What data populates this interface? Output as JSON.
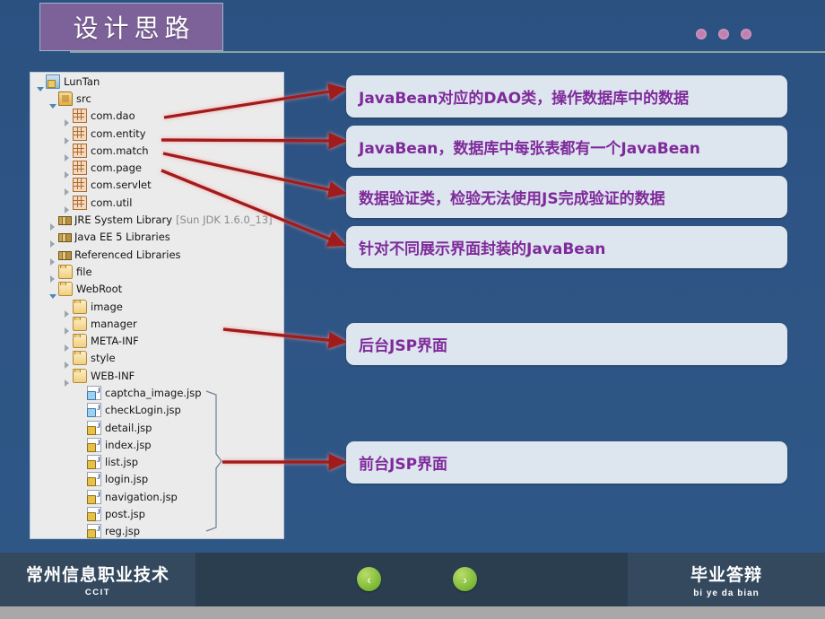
{
  "slide": {
    "title": "设计思路",
    "accent_banner_color": "#7d6199",
    "background_color": "#2b5181",
    "dots": [
      "dot-1",
      "dot-2",
      "dot-3"
    ],
    "dot_color": "#c07fb0"
  },
  "tree": {
    "panel_name": "project-explorer",
    "items": [
      {
        "label": "LunTan",
        "icon": "project-icon",
        "level": 0,
        "state": "expanded"
      },
      {
        "label": "src",
        "icon": "source-folder-icon",
        "level": 1,
        "state": "expanded"
      },
      {
        "label": "com.dao",
        "icon": "package-icon",
        "level": 2,
        "state": "collapsed"
      },
      {
        "label": "com.entity",
        "icon": "package-icon",
        "level": 2,
        "state": "collapsed"
      },
      {
        "label": "com.match",
        "icon": "package-icon",
        "level": 2,
        "state": "collapsed"
      },
      {
        "label": "com.page",
        "icon": "package-icon",
        "level": 2,
        "state": "collapsed"
      },
      {
        "label": "com.servlet",
        "icon": "package-icon",
        "level": 2,
        "state": "collapsed"
      },
      {
        "label": "com.util",
        "icon": "package-icon",
        "level": 2,
        "state": "collapsed"
      },
      {
        "label": "JRE System Library",
        "suffix": "[Sun JDK 1.6.0_13]",
        "icon": "library-icon",
        "level": 1,
        "state": "collapsed"
      },
      {
        "label": "Java EE 5 Libraries",
        "icon": "library-icon",
        "level": 1,
        "state": "collapsed"
      },
      {
        "label": "Referenced Libraries",
        "icon": "library-icon",
        "level": 1,
        "state": "collapsed"
      },
      {
        "label": "file",
        "icon": "folder-icon",
        "level": 1,
        "state": "collapsed"
      },
      {
        "label": "WebRoot",
        "icon": "folder-icon",
        "level": 1,
        "state": "expanded"
      },
      {
        "label": "image",
        "icon": "folder-icon",
        "level": 2,
        "state": "collapsed"
      },
      {
        "label": "manager",
        "icon": "folder-icon",
        "level": 2,
        "state": "collapsed"
      },
      {
        "label": "META-INF",
        "icon": "folder-icon",
        "level": 2,
        "state": "collapsed"
      },
      {
        "label": "style",
        "icon": "folder-icon",
        "level": 2,
        "state": "collapsed"
      },
      {
        "label": "WEB-INF",
        "icon": "folder-icon",
        "level": 2,
        "state": "collapsed"
      },
      {
        "label": "captcha_image.jsp",
        "icon": "jsp-file-icon",
        "level": 3,
        "state": "leaf"
      },
      {
        "label": "checkLogin.jsp",
        "icon": "jsp-file-icon",
        "level": 3,
        "state": "leaf"
      },
      {
        "label": "detail.jsp",
        "icon": "jsp-file-icon",
        "level": 3,
        "state": "leaf"
      },
      {
        "label": "index.jsp",
        "icon": "jsp-file-icon",
        "level": 3,
        "state": "leaf"
      },
      {
        "label": "list.jsp",
        "icon": "jsp-file-icon",
        "level": 3,
        "state": "leaf"
      },
      {
        "label": "login.jsp",
        "icon": "jsp-file-icon",
        "level": 3,
        "state": "leaf"
      },
      {
        "label": "navigation.jsp",
        "icon": "jsp-file-icon",
        "level": 3,
        "state": "leaf"
      },
      {
        "label": "post.jsp",
        "icon": "jsp-file-icon",
        "level": 3,
        "state": "leaf"
      },
      {
        "label": "reg.jsp",
        "icon": "jsp-file-icon",
        "level": 3,
        "state": "leaf"
      }
    ]
  },
  "callouts": [
    {
      "id": "callout-dao",
      "text": "JavaBean对应的DAO类，操作数据库中的数据"
    },
    {
      "id": "callout-entity",
      "text": "JavaBean，数据库中每张表都有一个JavaBean"
    },
    {
      "id": "callout-match",
      "text": "数据验证类，检验无法使用JS完成验证的数据"
    },
    {
      "id": "callout-page",
      "text": "针对不同展示界面封装的JavaBean"
    },
    {
      "id": "callout-manager",
      "text": "后台JSP界面"
    },
    {
      "id": "callout-frontend",
      "text": "前台JSP界面"
    }
  ],
  "callout_style": {
    "background": "#dde5ee",
    "text_color": "#7f2a9b",
    "arrow_color": "#a01a1a"
  },
  "footer": {
    "school_cn": "常州信息职业技术",
    "school_en": "CCIT",
    "topic_cn": "毕业答辩",
    "topic_en": "bi  ye da bian",
    "prev_label": "‹",
    "next_label": "›",
    "nav_color": "#7ab834"
  }
}
